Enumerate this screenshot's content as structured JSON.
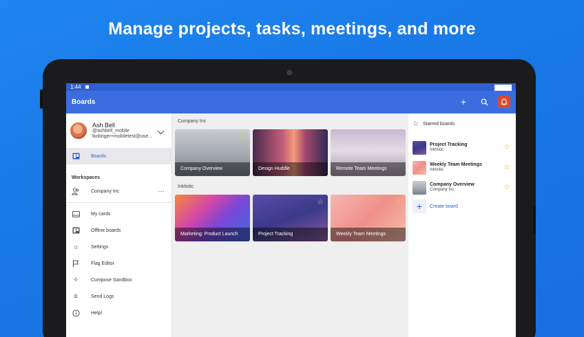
{
  "headline": "Manage projects, tasks, meetings, and more",
  "status_bar": {
    "time": "1:44"
  },
  "app_bar": {
    "title": "Boards",
    "add_icon": "plus-icon",
    "search_icon": "search-icon",
    "notifications_icon": "bell-icon"
  },
  "profile": {
    "name": "Ash Bell",
    "username": "@ashbell_mobile",
    "email": "lkobriger+mobiletest@use..."
  },
  "drawer": {
    "boards_label": "Boards",
    "workspaces_header": "Workspaces",
    "workspace_item": "Company Inc",
    "items": [
      {
        "label": "My cards",
        "icon": "card-icon"
      },
      {
        "label": "Offline boards",
        "icon": "board-icon"
      },
      {
        "label": "Settings",
        "icon": "gear-icon"
      },
      {
        "label": "Flag Editor",
        "icon": "flag-icon"
      },
      {
        "label": "Compose Sandbox",
        "icon": "sparkle-icon"
      },
      {
        "label": "Send Logs",
        "icon": "list-icon"
      },
      {
        "label": "Help!",
        "icon": "info-icon"
      }
    ]
  },
  "workspaces": [
    {
      "name": "Company Inc",
      "boards": [
        {
          "title": "Company Overview",
          "starred": true
        },
        {
          "title": "Design Huddle",
          "starred": false
        },
        {
          "title": "Remote Team Meetings",
          "starred": false
        }
      ]
    },
    {
      "name": "Inktistic",
      "boards": [
        {
          "title": "Marketing: Product Launch",
          "starred": false
        },
        {
          "title": "Project Tracking",
          "starred": true
        },
        {
          "title": "Weekly Team Meetings",
          "starred": true
        }
      ]
    }
  ],
  "starred_panel": {
    "header": "Starred boards",
    "items": [
      {
        "name": "Project Tracking",
        "workspace": "Inktistic"
      },
      {
        "name": "Weekly Team Meetings",
        "workspace": "Inktistic"
      },
      {
        "name": "Company Overview",
        "workspace": "Company Inc"
      }
    ],
    "create_label": "Create board"
  },
  "colors": {
    "app_bar": "#3b6de0",
    "accent": "#2e5bd3",
    "notification": "#d64a34",
    "star": "#f2c94c"
  }
}
